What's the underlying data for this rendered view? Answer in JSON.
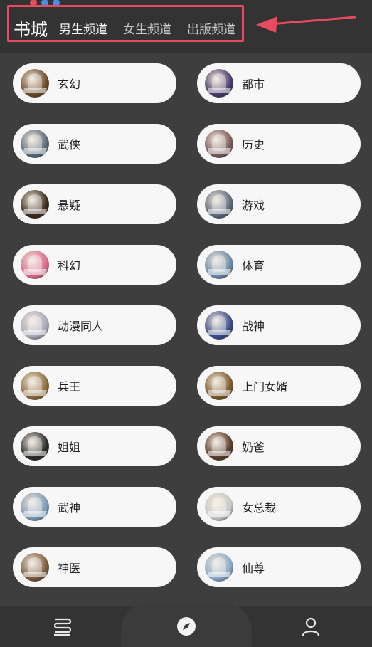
{
  "header": {
    "home_label": "书城",
    "tabs": [
      {
        "label": "男生频道",
        "active": true
      },
      {
        "label": "女生频道",
        "active": false
      },
      {
        "label": "出版频道",
        "active": false
      }
    ],
    "status_dot_colors": [
      "#e84a5f",
      "#4a8de8",
      "#4a8de8"
    ],
    "annotation_color": "#e84a5f"
  },
  "categories": [
    {
      "label": "玄幻",
      "icon": "book-cover-xuanhuan-icon",
      "color": "#6b4a2a"
    },
    {
      "label": "都市",
      "icon": "book-cover-dushi-icon",
      "color": "#4a3a6b"
    },
    {
      "label": "武侠",
      "icon": "book-cover-wuxia-icon",
      "color": "#5a6a7a"
    },
    {
      "label": "历史",
      "icon": "book-cover-lishi-icon",
      "color": "#7a5a5a"
    },
    {
      "label": "悬疑",
      "icon": "book-cover-xuanyi-icon",
      "color": "#3a2a1a"
    },
    {
      "label": "游戏",
      "icon": "book-cover-youxi-icon",
      "color": "#5a6a7a"
    },
    {
      "label": "科幻",
      "icon": "book-cover-kehuan-icon",
      "color": "#d86a8a"
    },
    {
      "label": "体育",
      "icon": "book-cover-tiyu-icon",
      "color": "#6a8aa8"
    },
    {
      "label": "动漫同人",
      "icon": "book-cover-dongman-icon",
      "color": "#a8a8b8"
    },
    {
      "label": "战神",
      "icon": "book-cover-zhanshen-icon",
      "color": "#3a4a8a"
    },
    {
      "label": "兵王",
      "icon": "book-cover-bingwang-icon",
      "color": "#8a6a3a"
    },
    {
      "label": "上门女婿",
      "icon": "book-cover-shangmen-icon",
      "color": "#7a5a2a"
    },
    {
      "label": "姐姐",
      "icon": "book-cover-jiejie-icon",
      "color": "#2a2a2a"
    },
    {
      "label": "奶爸",
      "icon": "book-cover-naiba-icon",
      "color": "#5a3a2a"
    },
    {
      "label": "武神",
      "icon": "book-cover-wushen-icon",
      "color": "#7a9ab8"
    },
    {
      "label": "女总裁",
      "icon": "book-cover-nvzongcai-icon",
      "color": "#c8c8c8"
    },
    {
      "label": "神医",
      "icon": "book-cover-shenyi-icon",
      "color": "#7a5a3a"
    },
    {
      "label": "仙尊",
      "icon": "book-cover-xianzun-icon",
      "color": "#8aa8c8"
    }
  ],
  "bottom_nav": [
    {
      "icon": "bookshelf-icon"
    },
    {
      "icon": "compass-icon"
    },
    {
      "icon": "user-icon"
    }
  ]
}
